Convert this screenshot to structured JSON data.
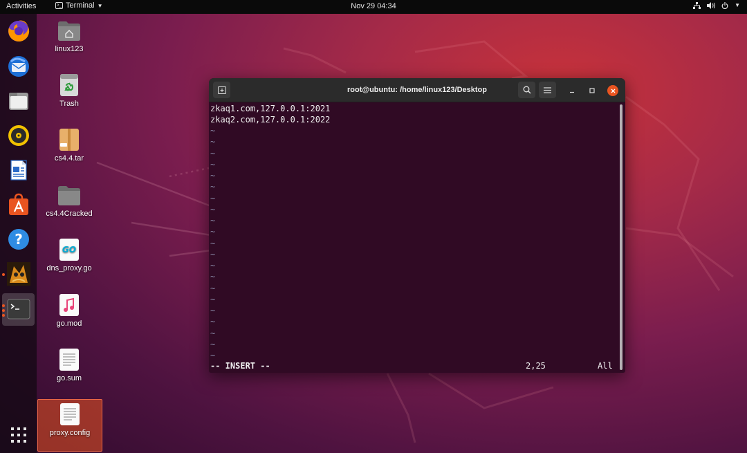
{
  "topbar": {
    "activities": "Activities",
    "app_name": "Terminal",
    "clock": "Nov 29  04:34"
  },
  "desktop": {
    "icons": [
      {
        "label": "linux123",
        "icon": "home-folder-icon"
      },
      {
        "label": "Trash",
        "icon": "trash-icon"
      },
      {
        "label": "cs4.4.tar",
        "icon": "archive-icon"
      },
      {
        "label": "cs4.4Cracked",
        "icon": "folder-icon"
      },
      {
        "label": "dns_proxy.go",
        "icon": "go-file-icon"
      },
      {
        "label": "go.mod",
        "icon": "music-file-icon"
      },
      {
        "label": "go.sum",
        "icon": "text-file-icon"
      },
      {
        "label": "proxy.config",
        "icon": "text-file-icon"
      }
    ],
    "selected": "proxy.config"
  },
  "dock": {
    "items": [
      "firefox-icon",
      "thunderbird-icon",
      "files-icon",
      "rhythmbox-icon",
      "writer-icon",
      "software-icon",
      "help-icon",
      "app-icon",
      "terminal-icon"
    ],
    "show_apps": "show-applications-icon"
  },
  "terminal": {
    "title": "root@ubuntu: /home/linux123/Desktop",
    "lines": [
      "zkaq1.com,127.0.0.1:2021",
      "zkaq2.com,127.0.0.1:2022"
    ],
    "empty_marker": "~",
    "mode": "-- INSERT --",
    "cursor_pos": "2,25",
    "scroll_pos": "All"
  },
  "colors": {
    "terminal_bg": "#300a24",
    "accent": "#e95420"
  }
}
